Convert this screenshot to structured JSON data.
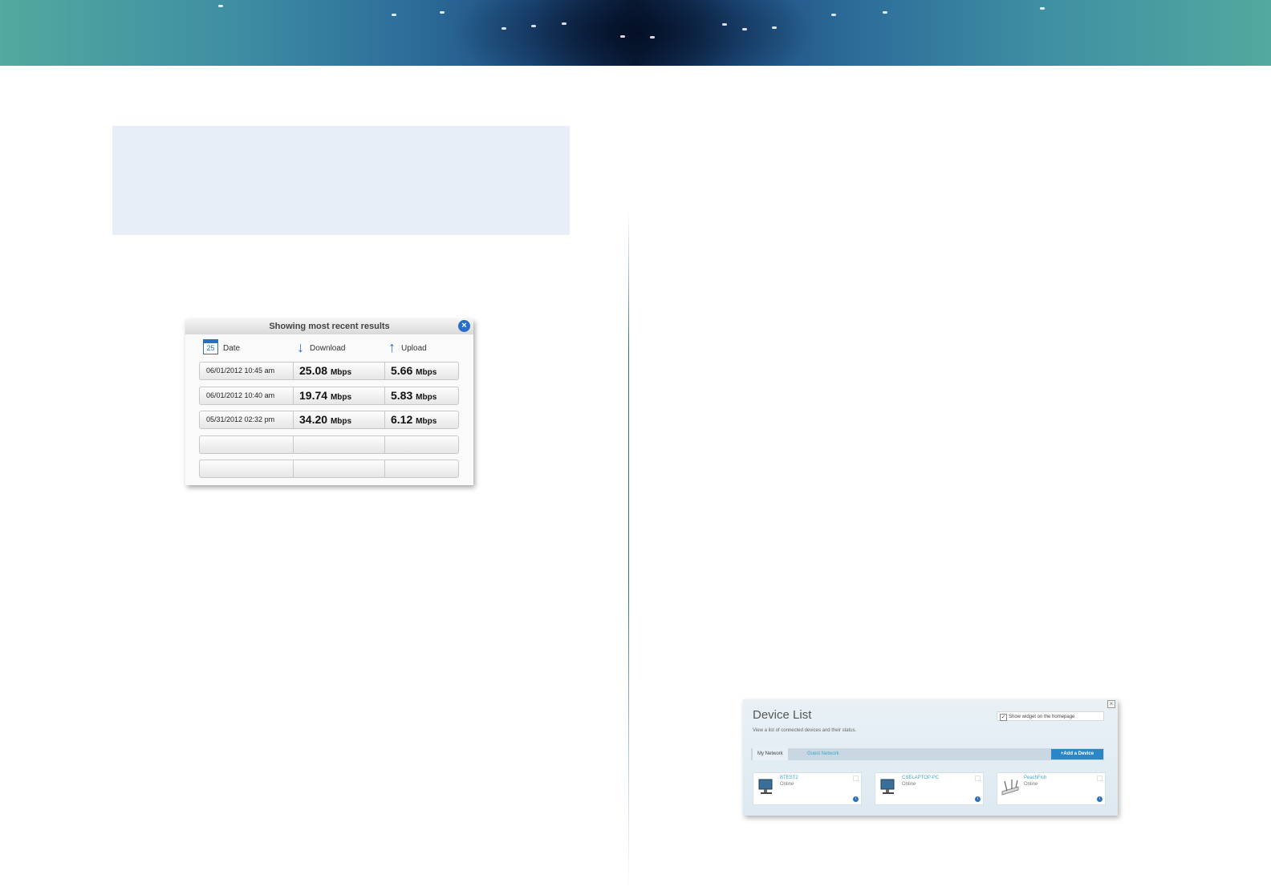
{
  "speed_results": {
    "title": "Showing most recent results",
    "close_icon": "×",
    "columns": {
      "date": "Date",
      "download": "Download",
      "upload": "Upload"
    },
    "calendar_day": "25",
    "rows": [
      {
        "date": "06/01/2012 10:45 am",
        "download": "25.08",
        "upload": "5.66",
        "unit": "Mbps"
      },
      {
        "date": "06/01/2012 10:40 am",
        "download": "19.74",
        "upload": "5.83",
        "unit": "Mbps"
      },
      {
        "date": "05/31/2012 02:32 pm",
        "download": "34.20",
        "upload": "6.12",
        "unit": "Mbps"
      }
    ],
    "accent_color": "#2a6fc7"
  },
  "device_list": {
    "title": "Device List",
    "subtitle": "View a list of connected devices and their status.",
    "show_widget_label": "Show widget on the homepage",
    "show_widget_checked": true,
    "tabs": [
      "My Network",
      "Guest Network"
    ],
    "add_button": "+Add a Device",
    "devices": [
      {
        "name": "BTEST2",
        "status": "Online",
        "icon": "desktop-computer-icon"
      },
      {
        "name": "CSELAPTOP-PC",
        "status": "Online",
        "icon": "desktop-computer-icon"
      },
      {
        "name": "PeachFish",
        "status": "Online",
        "icon": "router-icon"
      }
    ],
    "accent_color": "#2b86c8"
  }
}
